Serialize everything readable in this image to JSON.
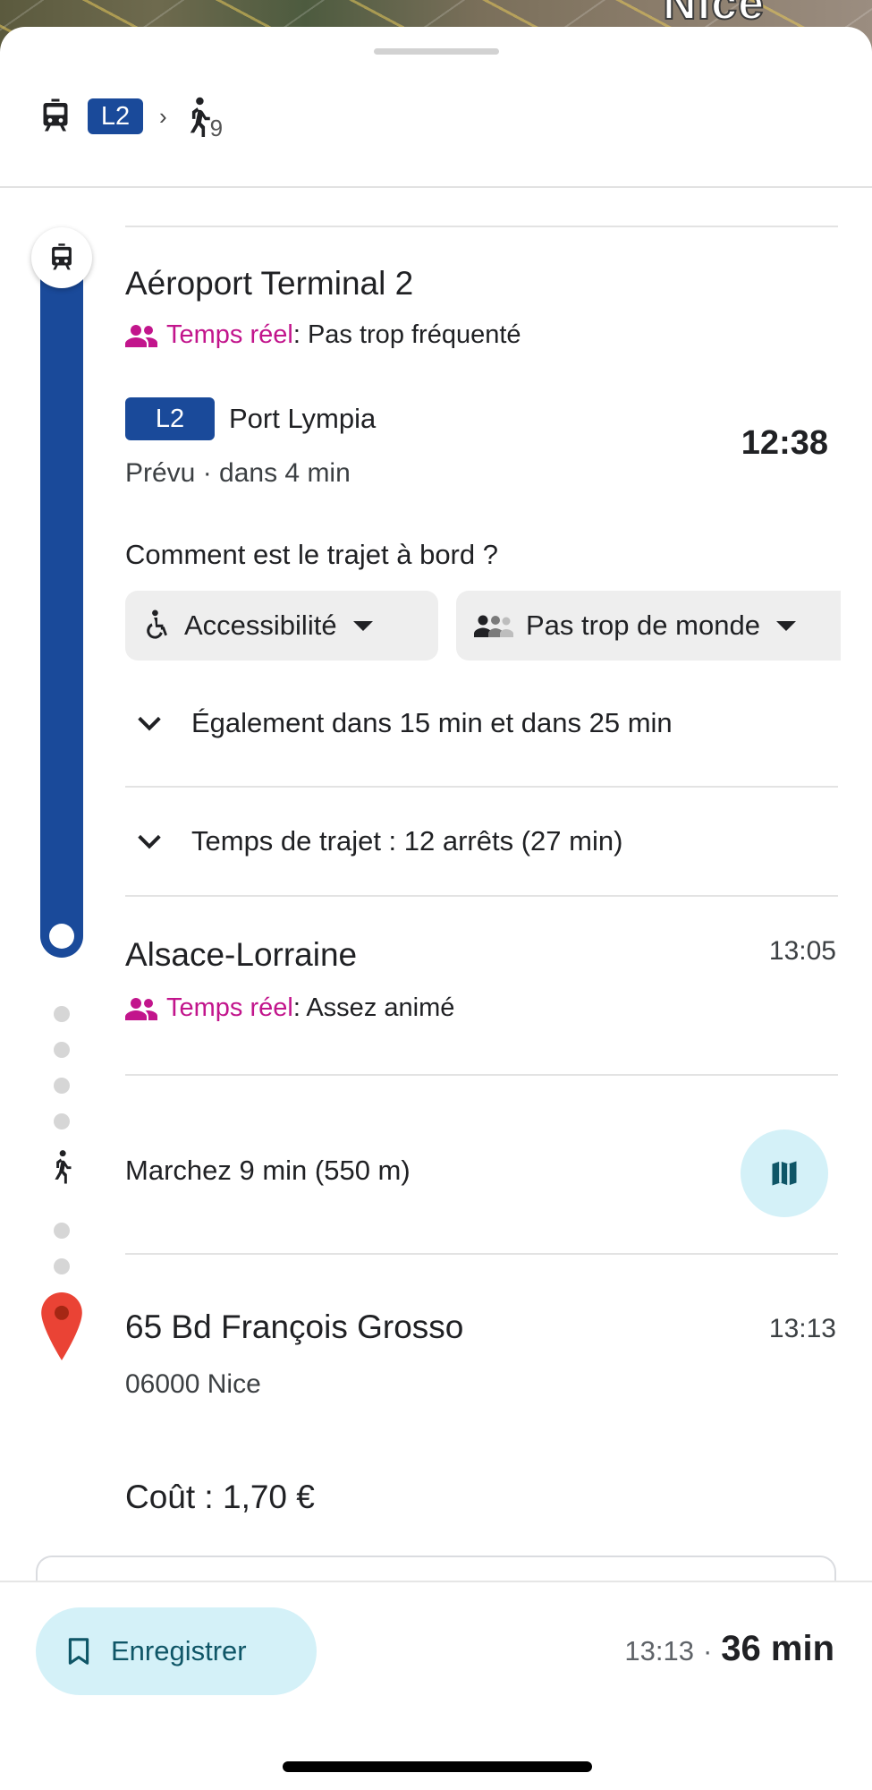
{
  "map": {
    "city_label": "Nice"
  },
  "summary": {
    "tram_icon": "tram-icon",
    "line": "L2",
    "chevron": "›",
    "walk_icon": "walk-icon",
    "walk_minutes": "9"
  },
  "departure": {
    "stop": "Aéroport Terminal 2",
    "realtime_label": "Temps réel",
    "realtime_status": ": Pas trop fréquenté",
    "line": "L2",
    "direction": "Port Lympia",
    "schedule": "Prévu · dans 4 min",
    "time": "12:38",
    "question": "Comment est le trajet à bord ?",
    "chip_accessibility": "Accessibilité",
    "chip_crowd": "Pas trop de monde",
    "also": "Également dans 15 min et dans 25 min",
    "trip": "Temps de trajet : 12 arrêts (27 min)"
  },
  "arrival_stop": {
    "stop": "Alsace-Lorraine",
    "time": "13:05",
    "realtime_label": "Temps réel",
    "realtime_status": ": Assez animé"
  },
  "walk": {
    "text": "Marchez 9 min (550 m)"
  },
  "destination": {
    "address": "65 Bd François Grosso",
    "city": "06000 Nice",
    "time": "13:13"
  },
  "cost": "Coût : 1,70 €",
  "footer": {
    "save_label": "Enregistrer",
    "arrival_time": "13:13",
    "separator": "·",
    "duration": "36 min"
  },
  "colors": {
    "line_blue": "#1a4a9a",
    "realtime_magenta": "#c2158c",
    "pin_red": "#ea4335",
    "button_cyan": "#d4f1f8"
  }
}
